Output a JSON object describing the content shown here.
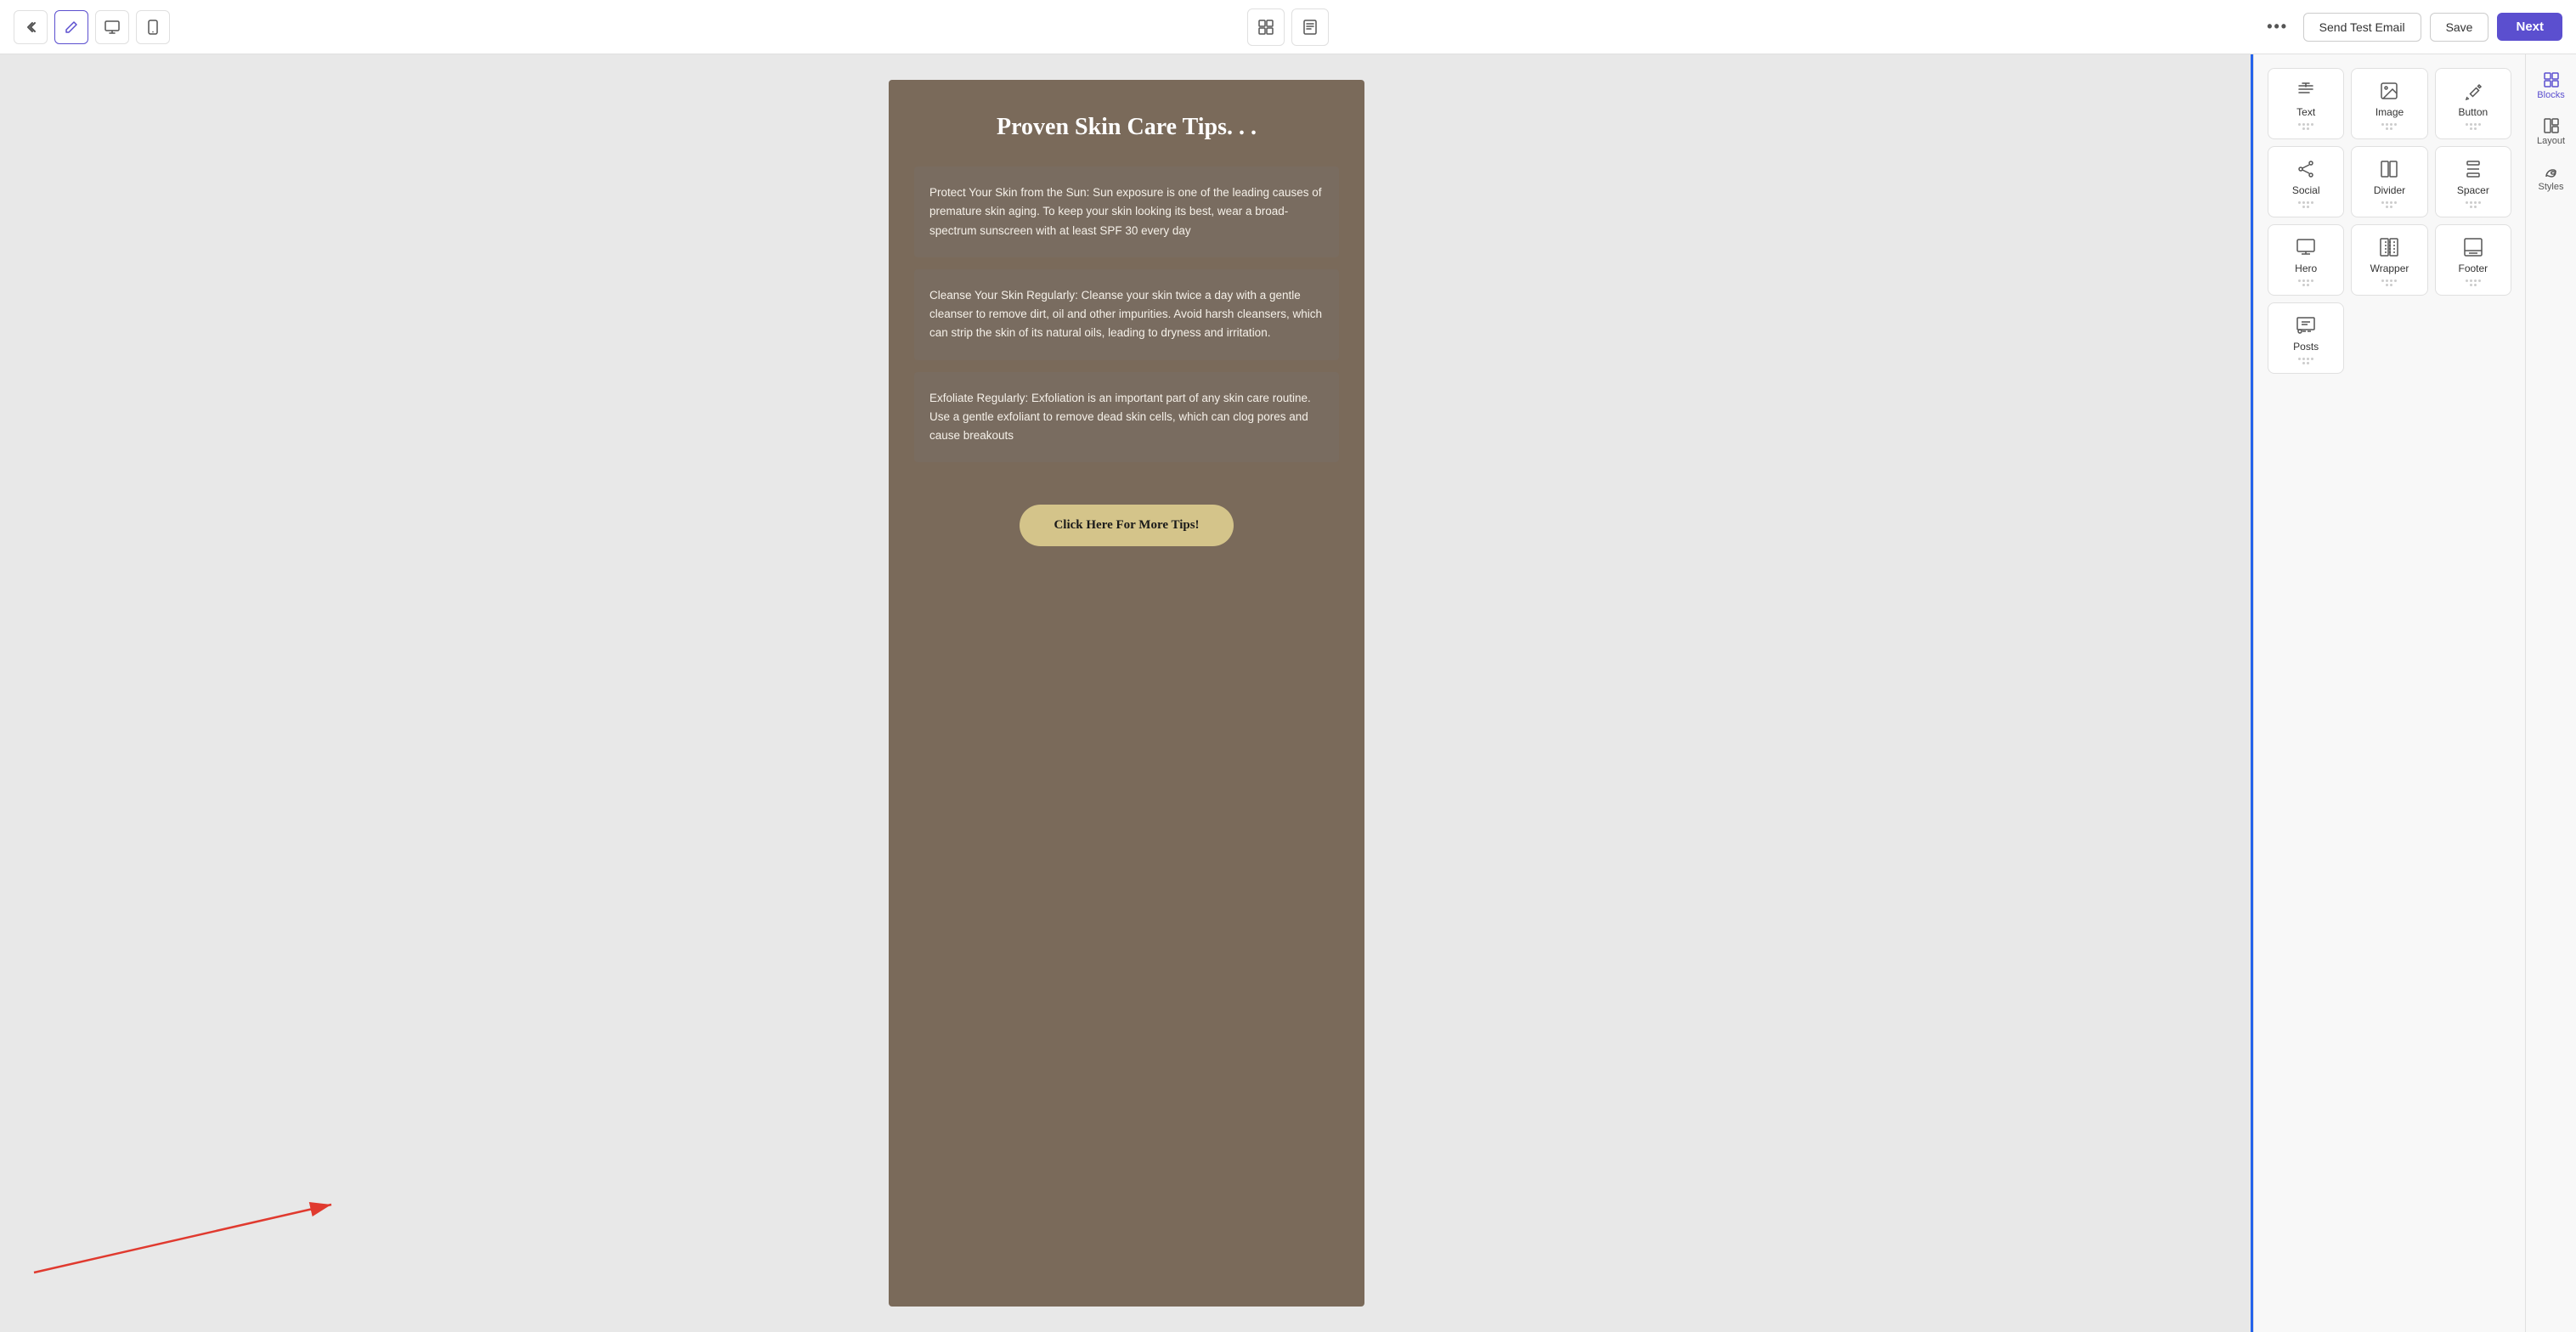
{
  "toolbar": {
    "back_icon": "«",
    "edit_icon": "✏",
    "desktop_icon": "🖥",
    "mobile_icon": "📱",
    "grid_icon": "⊞",
    "note_icon": "🗒",
    "more_icon": "•••",
    "send_test_label": "Send Test Email",
    "save_label": "Save",
    "next_label": "Next"
  },
  "email": {
    "title": "Proven Skin Care Tips. . .",
    "tips": [
      {
        "text": "Protect Your Skin from the Sun: Sun exposure is one of the leading causes of premature skin aging. To keep your skin looking its best, wear a broad-spectrum sunscreen with at least SPF 30 every day"
      },
      {
        "text": "Cleanse Your Skin Regularly: Cleanse your skin twice a day with a gentle cleanser to remove dirt, oil and other impurities. Avoid harsh cleansers, which can strip the skin of its natural oils, leading to dryness and irritation."
      },
      {
        "text": "Exfoliate Regularly: Exfoliation is an important part of any skin care routine. Use a gentle exfoliant to remove dead skin cells, which can clog pores and cause breakouts"
      }
    ],
    "cta_label": "Click Here For More Tips!"
  },
  "sidebar": {
    "nav_tabs": [
      {
        "id": "blocks",
        "label": "Blocks",
        "active": true
      },
      {
        "id": "layout",
        "label": "Layout",
        "active": false
      },
      {
        "id": "styles",
        "label": "Styles",
        "active": false
      }
    ],
    "blocks": [
      {
        "id": "text",
        "label": "Text"
      },
      {
        "id": "image",
        "label": "Image"
      },
      {
        "id": "button",
        "label": "Button"
      },
      {
        "id": "social",
        "label": "Social"
      },
      {
        "id": "divider",
        "label": "Divider"
      },
      {
        "id": "spacer",
        "label": "Spacer"
      },
      {
        "id": "hero",
        "label": "Hero"
      },
      {
        "id": "wrapper",
        "label": "Wrapper"
      },
      {
        "id": "footer",
        "label": "Footer"
      },
      {
        "id": "posts",
        "label": "Posts"
      }
    ]
  }
}
